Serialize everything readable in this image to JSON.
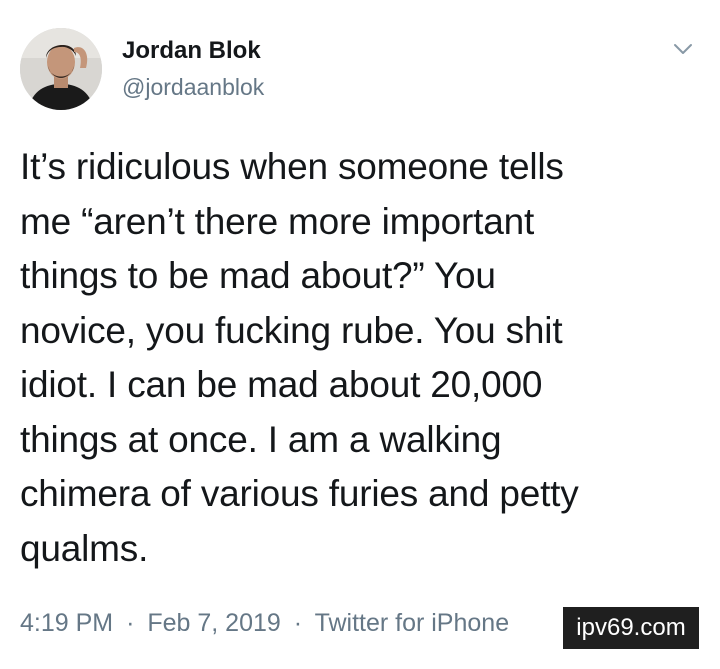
{
  "user": {
    "name": "Jordan Blok",
    "handle": "@jordaanblok"
  },
  "tweet": {
    "text": "It’s ridiculous when someone tells\nme “aren’t there more important\nthings to be mad about?” You\nnovice, you fucking rube. You shit\nidiot. I can be mad about 20,000\nthings at once. I am a walking\nchimera of various furies and petty\nqualms."
  },
  "meta": {
    "time": "4:19 PM",
    "separator": "·",
    "date": "Feb 7, 2019",
    "source": "Twitter for iPhone"
  },
  "watermark": "ipv69.com",
  "icons": {
    "menu": "chevron-down-icon"
  },
  "colors": {
    "name": "#14171a",
    "secondary": "#657786",
    "caret": "#8899a6"
  }
}
